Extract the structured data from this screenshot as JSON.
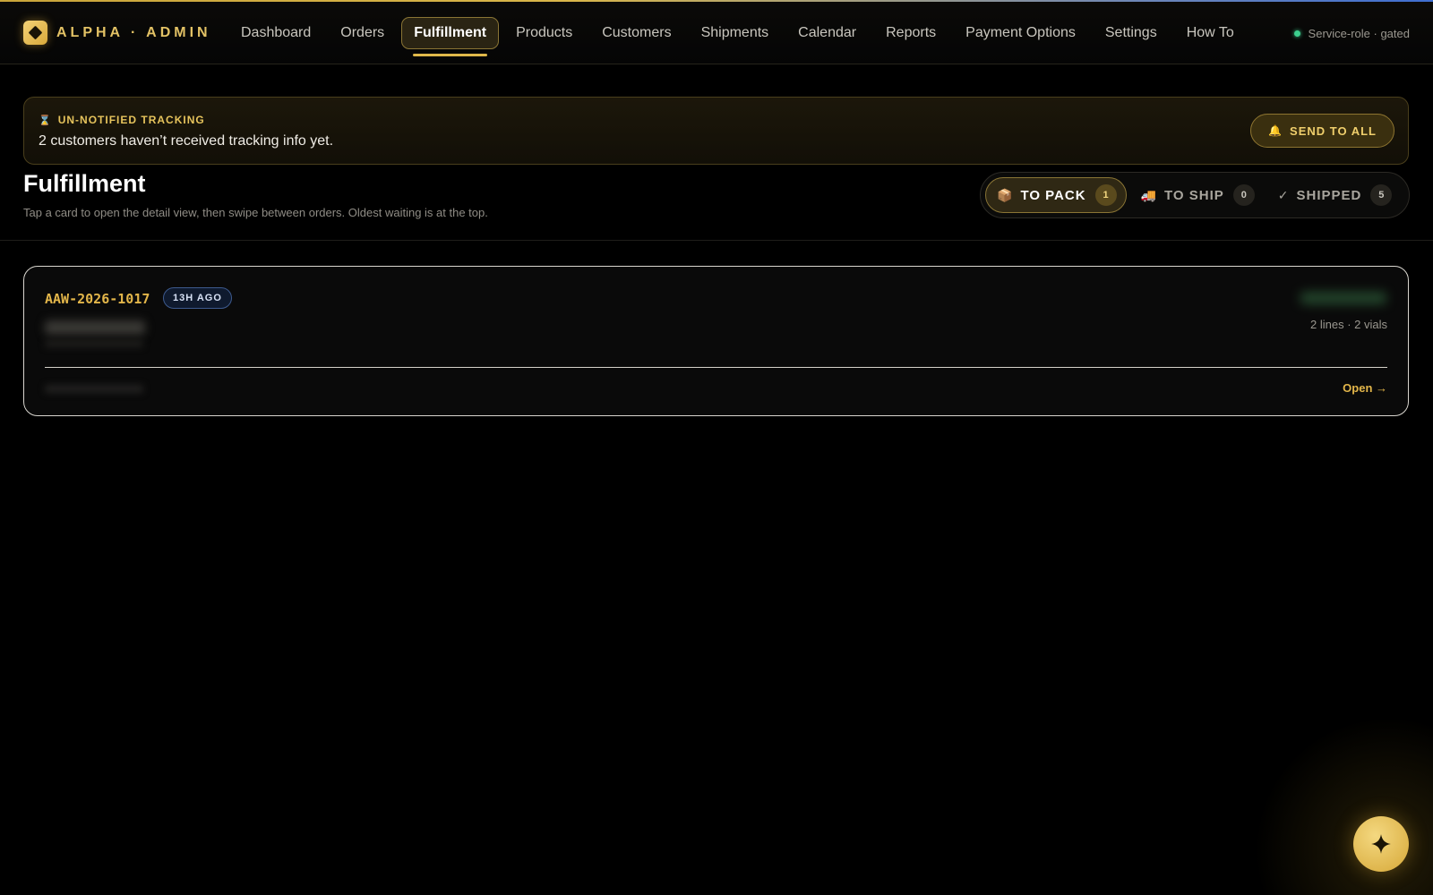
{
  "brand": {
    "name": "ALPHA · ADMIN"
  },
  "nav": {
    "items": [
      {
        "label": "Dashboard"
      },
      {
        "label": "Orders"
      },
      {
        "label": "Fulfillment",
        "active": true
      },
      {
        "label": "Products"
      },
      {
        "label": "Customers"
      },
      {
        "label": "Shipments"
      },
      {
        "label": "Calendar"
      },
      {
        "label": "Reports"
      },
      {
        "label": "Payment Options"
      },
      {
        "label": "Settings"
      },
      {
        "label": "How To"
      }
    ],
    "status": "Service-role · gated"
  },
  "banner": {
    "icon": "hourglass-icon",
    "kicker": "UN-NOTIFIED TRACKING",
    "message": "2 customers haven’t received tracking info yet.",
    "action": "SEND TO ALL",
    "action_icon": "bell-icon"
  },
  "page": {
    "title": "Fulfillment",
    "subtitle": "Tap a card to open the detail view, then swipe between orders. Oldest waiting is at the top."
  },
  "tabs": [
    {
      "label": "TO PACK",
      "count": "1",
      "icon": "package-icon",
      "active": true
    },
    {
      "label": "TO SHIP",
      "count": "0",
      "icon": "truck-icon"
    },
    {
      "label": "SHIPPED",
      "count": "5",
      "icon": "check-icon"
    }
  ],
  "order": {
    "id": "AAW-2026-1017",
    "age": "13H AGO",
    "summary": "2 lines · 2 vials",
    "open_label": "Open →"
  },
  "colors": {
    "accent": "#e3b64a",
    "background": "#000000",
    "status_ok": "#3ccf8e"
  },
  "fab": {
    "icon": "sparkle-icon"
  }
}
